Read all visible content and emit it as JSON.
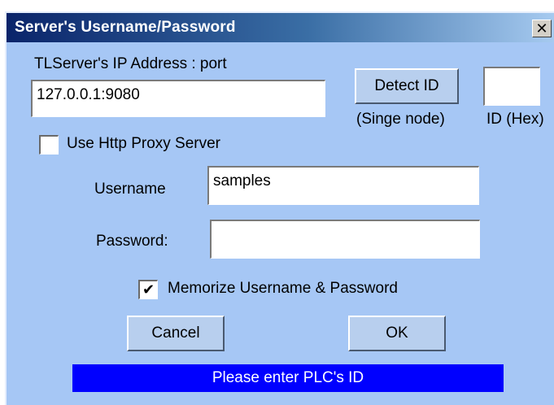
{
  "window": {
    "title": "Server's Username/Password",
    "close_glyph": "✕"
  },
  "server": {
    "label": "TLServer's IP Address : port",
    "value": "127.0.0.1:9080"
  },
  "detect": {
    "button_label": "Detect ID",
    "note": "(Singe node)",
    "id_label": "ID (Hex)",
    "id_value": ""
  },
  "proxy": {
    "label": "Use Http Proxy Server",
    "checked": false
  },
  "username": {
    "label": "Username",
    "value": "samples"
  },
  "password": {
    "label": "Password:",
    "value": ""
  },
  "memorize": {
    "label": "Memorize Username & Password",
    "checked": true,
    "check_glyph": "✔"
  },
  "buttons": {
    "cancel": "Cancel",
    "ok": "OK"
  },
  "status": {
    "message": "Please enter PLC's ID",
    "color": "#0000ff"
  },
  "colors": {
    "dialog_bg": "#a6c7f5",
    "title_start": "#0a246a",
    "title_end": "#a6caf0"
  },
  "icons": {
    "close": "close-icon",
    "check": "checkmark-icon"
  }
}
